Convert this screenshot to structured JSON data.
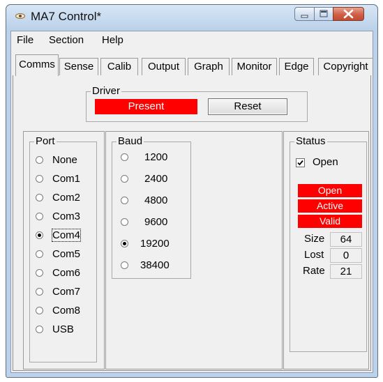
{
  "window": {
    "title": "MA7 Control*"
  },
  "menu": [
    "File",
    "Section",
    "Help"
  ],
  "tabs": [
    "Comms",
    "Sense",
    "Calib",
    "Output",
    "Graph",
    "Monitor",
    "Edge",
    "Copyright"
  ],
  "driver": {
    "caption": "Driver",
    "status_label": "Present",
    "reset_label": "Reset",
    "status_color": "#ff0000"
  },
  "port": {
    "caption": "Port",
    "options": [
      "None",
      "Com1",
      "Com2",
      "Com3",
      "Com4",
      "Com5",
      "Com6",
      "Com7",
      "Com8",
      "USB"
    ],
    "selected": "Com4"
  },
  "baud": {
    "caption": "Baud",
    "options": [
      "1200",
      "2400",
      "4800",
      "9600",
      "19200",
      "38400"
    ],
    "selected": "19200"
  },
  "status": {
    "caption": "Status",
    "open_checkbox_label": "Open",
    "open_checked": true,
    "indicators": [
      "Open",
      "Active",
      "Valid"
    ],
    "indicator_color": "#ff0000",
    "size_label": "Size",
    "size_value": "64",
    "lost_label": "Lost",
    "lost_value": "0",
    "rate_label": "Rate",
    "rate_value": "21"
  }
}
